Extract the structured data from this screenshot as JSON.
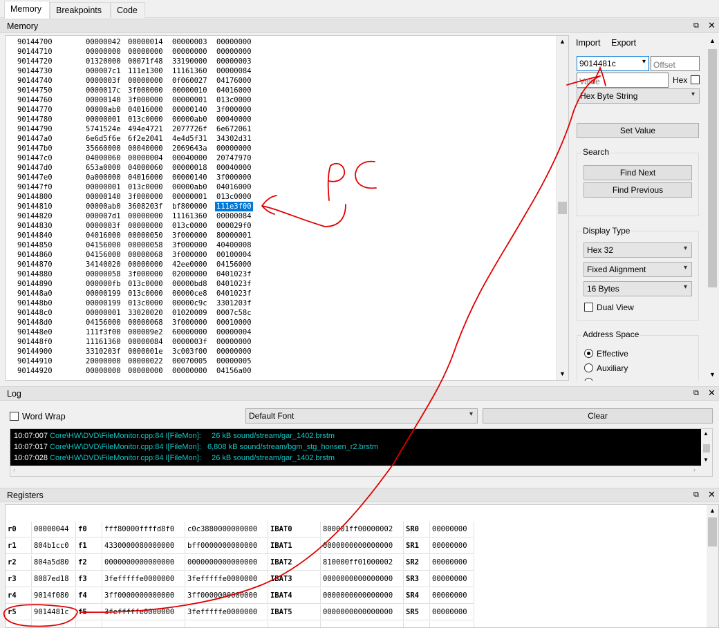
{
  "tabs": [
    "Memory",
    "Breakpoints",
    "Code"
  ],
  "memory_panel": {
    "title": "Memory",
    "rows": [
      {
        "addr": "90144700",
        "w": [
          "00000042",
          "00000014",
          "00000003",
          "00000000"
        ]
      },
      {
        "addr": "90144710",
        "w": [
          "00000000",
          "00000000",
          "00000000",
          "00000000"
        ]
      },
      {
        "addr": "90144720",
        "w": [
          "01320000",
          "00071f48",
          "33190000",
          "00000003"
        ]
      },
      {
        "addr": "90144730",
        "w": [
          "000007c1",
          "111e1300",
          "11161360",
          "00000084"
        ]
      },
      {
        "addr": "90144740",
        "w": [
          "0000003f",
          "00000000",
          "0f060027",
          "04176000"
        ]
      },
      {
        "addr": "90144750",
        "w": [
          "0000017c",
          "3f000000",
          "00000010",
          "04016000"
        ]
      },
      {
        "addr": "90144760",
        "w": [
          "00000140",
          "3f000000",
          "00000001",
          "013c0000"
        ]
      },
      {
        "addr": "90144770",
        "w": [
          "00000ab0",
          "04016000",
          "00000140",
          "3f000000"
        ]
      },
      {
        "addr": "90144780",
        "w": [
          "00000001",
          "013c0000",
          "00000ab0",
          "00040000"
        ]
      },
      {
        "addr": "90144790",
        "w": [
          "5741524e",
          "494e4721",
          "2077726f",
          "6e672061"
        ]
      },
      {
        "addr": "901447a0",
        "w": [
          "6e6d5f6e",
          "6f2e2041",
          "4e4d5f31",
          "34302d31"
        ]
      },
      {
        "addr": "901447b0",
        "w": [
          "35660000",
          "00040000",
          "2069643a",
          "00000000"
        ]
      },
      {
        "addr": "901447c0",
        "w": [
          "04000060",
          "00000004",
          "00040000",
          "20747970"
        ]
      },
      {
        "addr": "901447d0",
        "w": [
          "653a0000",
          "04000060",
          "00000018",
          "00040000"
        ]
      },
      {
        "addr": "901447e0",
        "w": [
          "0a000000",
          "04016000",
          "00000140",
          "3f000000"
        ]
      },
      {
        "addr": "901447f0",
        "w": [
          "00000001",
          "013c0000",
          "00000ab0",
          "04016000"
        ]
      },
      {
        "addr": "90144800",
        "w": [
          "00000140",
          "3f000000",
          "00000001",
          "013c0000"
        ]
      },
      {
        "addr": "90144810",
        "w": [
          "00000ab0",
          "3608203f",
          "bf800000",
          "111e3f00"
        ]
      },
      {
        "addr": "90144820",
        "w": [
          "000007d1",
          "00000000",
          "11161360",
          "00000084"
        ]
      },
      {
        "addr": "90144830",
        "w": [
          "0000003f",
          "00000000",
          "013c0000",
          "000029f0"
        ]
      },
      {
        "addr": "90144840",
        "w": [
          "04016000",
          "00000050",
          "3f000000",
          "80000001"
        ]
      },
      {
        "addr": "90144850",
        "w": [
          "04156000",
          "00000058",
          "3f000000",
          "40400008"
        ]
      },
      {
        "addr": "90144860",
        "w": [
          "04156000",
          "00000068",
          "3f000000",
          "00100004"
        ]
      },
      {
        "addr": "90144870",
        "w": [
          "34140020",
          "00000000",
          "42ee0000",
          "04156000"
        ]
      },
      {
        "addr": "90144880",
        "w": [
          "00000058",
          "3f000000",
          "02000000",
          "0401023f"
        ]
      },
      {
        "addr": "90144890",
        "w": [
          "000000fb",
          "013c0000",
          "00000bd8",
          "0401023f"
        ]
      },
      {
        "addr": "901448a0",
        "w": [
          "00000199",
          "013c0000",
          "00000ce8",
          "0401023f"
        ]
      },
      {
        "addr": "901448b0",
        "w": [
          "00000199",
          "013c0000",
          "00000c9c",
          "3301203f"
        ]
      },
      {
        "addr": "901448c0",
        "w": [
          "00000001",
          "33020020",
          "01020009",
          "0007c58c"
        ]
      },
      {
        "addr": "901448d0",
        "w": [
          "04156000",
          "00000068",
          "3f000000",
          "00010000"
        ]
      },
      {
        "addr": "901448e0",
        "w": [
          "111f3f00",
          "000009e2",
          "60000000",
          "00000004"
        ]
      },
      {
        "addr": "901448f0",
        "w": [
          "11161360",
          "00000084",
          "0000003f",
          "00000000"
        ]
      },
      {
        "addr": "90144900",
        "w": [
          "3310203f",
          "0000001e",
          "3c003f00",
          "00000000"
        ]
      },
      {
        "addr": "90144910",
        "w": [
          "20000000",
          "00000022",
          "00070005",
          "00000005"
        ]
      },
      {
        "addr": "90144920",
        "w": [
          "00000000",
          "00000000",
          "00000000",
          "04156a00"
        ]
      }
    ],
    "annotation": "PC",
    "side": {
      "import_label": "Import",
      "export_label": "Export",
      "address_value": "9014481c",
      "offset_placeholder": "Offset",
      "value_placeholder": "Value",
      "hex_label": "Hex",
      "value_type": "Hex Byte String",
      "set_value_label": "Set Value",
      "search_label": "Search",
      "find_next_label": "Find Next",
      "find_previous_label": "Find Previous",
      "display_type_label": "Display Type",
      "display_type_value": "Hex 32",
      "alignment_value": "Fixed Alignment",
      "bytes_value": "16 Bytes",
      "dual_view_label": "Dual View",
      "address_space_label": "Address Space",
      "effective_label": "Effective",
      "auxiliary_label": "Auxiliary"
    }
  },
  "log_panel": {
    "title": "Log",
    "word_wrap_label": "Word Wrap",
    "font_value": "Default Font",
    "clear_label": "Clear",
    "lines": [
      {
        "time": "10:07:007",
        "text": " Core\\HW\\DVD\\FileMonitor.cpp:84 I[FileMon]:     26 kB sound/stream/gar_1402.brstm"
      },
      {
        "time": "10:07:017",
        "text": " Core\\HW\\DVD\\FileMonitor.cpp:84 I[FileMon]:   6,808 kB sound/stream/bgm_stg_honsen_r2.brstm"
      },
      {
        "time": "10:07:028",
        "text": " Core\\HW\\DVD\\FileMonitor.cpp:84 I[FileMon]:     26 kB sound/stream/gar_1402.brstm"
      }
    ]
  },
  "registers_panel": {
    "title": "Registers",
    "rows": [
      {
        "gpr": "r0",
        "gval": "00000044",
        "fpr": "f0",
        "f1": "fff80000ffffd8f0",
        "f2": "c0c3880000000000",
        "bat": "IBAT0",
        "batv": "800001ff00000002",
        "sr": "SR0",
        "srv": "00000000"
      },
      {
        "gpr": "r1",
        "gval": "804b1cc0",
        "fpr": "f1",
        "f1": "4330000080000000",
        "f2": "bff0000000000000",
        "bat": "IBAT1",
        "batv": "0000000000000000",
        "sr": "SR1",
        "srv": "00000000"
      },
      {
        "gpr": "r2",
        "gval": "804a5d80",
        "fpr": "f2",
        "f1": "0000000000000000",
        "f2": "0000000000000000",
        "bat": "IBAT2",
        "batv": "810000ff01000002",
        "sr": "SR2",
        "srv": "00000000"
      },
      {
        "gpr": "r3",
        "gval": "8087ed18",
        "fpr": "f3",
        "f1": "3fefffffe0000000",
        "f2": "3fefffffe0000000",
        "bat": "IBAT3",
        "batv": "0000000000000000",
        "sr": "SR3",
        "srv": "00000000"
      },
      {
        "gpr": "r4",
        "gval": "9014f080",
        "fpr": "f4",
        "f1": "3ff0000000000000",
        "f2": "3ff0000000000000",
        "bat": "IBAT4",
        "batv": "0000000000000000",
        "sr": "SR4",
        "srv": "00000000"
      },
      {
        "gpr": "r5",
        "gval": "9014481c",
        "fpr": "f5",
        "f1": "3fefffffe0000000",
        "f2": "3fefffffe0000000",
        "bat": "IBAT5",
        "batv": "0000000000000000",
        "sr": "SR5",
        "srv": "00000000"
      }
    ]
  },
  "colors": {
    "selection": "#0078d7",
    "log_background": "#000000",
    "log_text": "#16c6c6",
    "annotation": "#e00000"
  }
}
